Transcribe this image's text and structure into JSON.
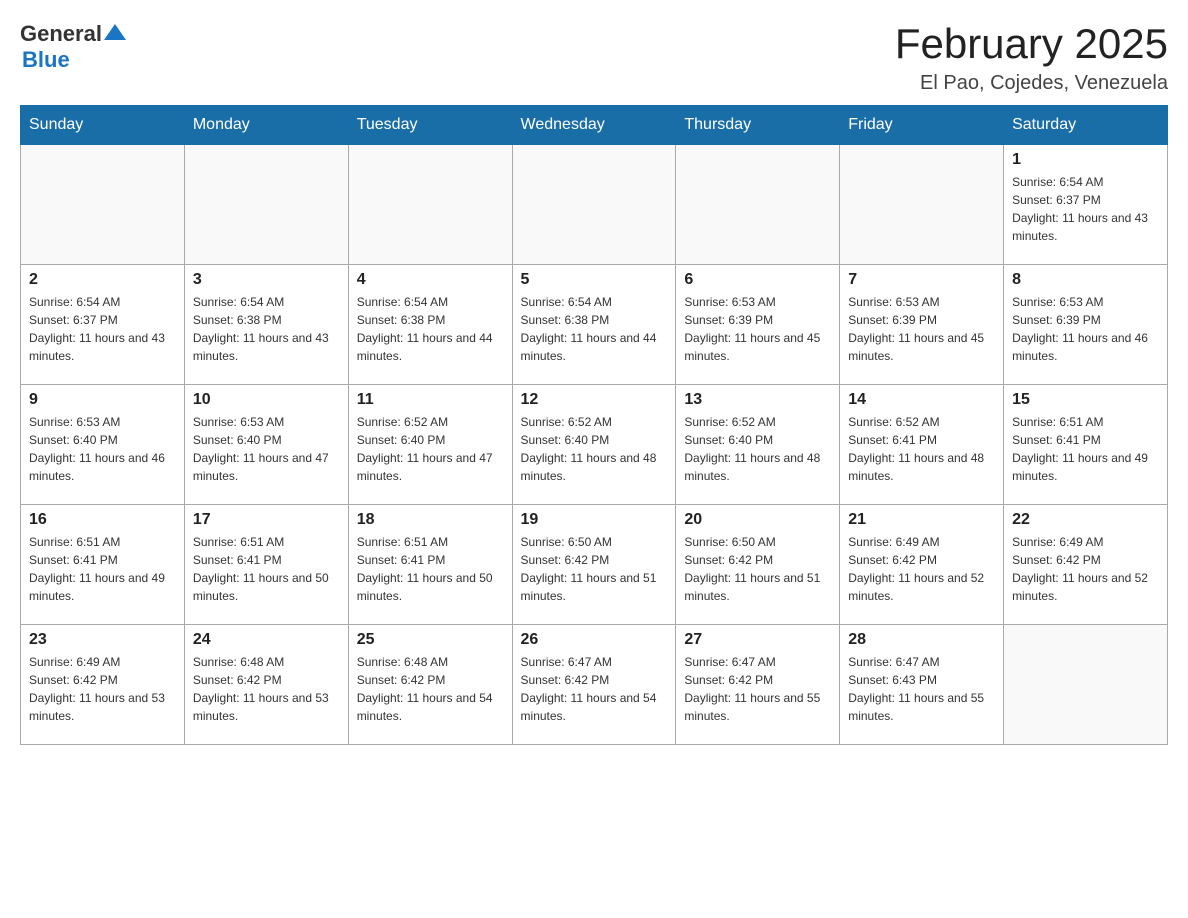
{
  "header": {
    "logo": {
      "general": "General",
      "triangle": "▲",
      "blue": "Blue"
    },
    "title": "February 2025",
    "subtitle": "El Pao, Cojedes, Venezuela"
  },
  "calendar": {
    "days": [
      "Sunday",
      "Monday",
      "Tuesday",
      "Wednesday",
      "Thursday",
      "Friday",
      "Saturday"
    ],
    "weeks": [
      [
        {
          "day": "",
          "info": ""
        },
        {
          "day": "",
          "info": ""
        },
        {
          "day": "",
          "info": ""
        },
        {
          "day": "",
          "info": ""
        },
        {
          "day": "",
          "info": ""
        },
        {
          "day": "",
          "info": ""
        },
        {
          "day": "1",
          "info": "Sunrise: 6:54 AM\nSunset: 6:37 PM\nDaylight: 11 hours and 43 minutes."
        }
      ],
      [
        {
          "day": "2",
          "info": "Sunrise: 6:54 AM\nSunset: 6:37 PM\nDaylight: 11 hours and 43 minutes."
        },
        {
          "day": "3",
          "info": "Sunrise: 6:54 AM\nSunset: 6:38 PM\nDaylight: 11 hours and 43 minutes."
        },
        {
          "day": "4",
          "info": "Sunrise: 6:54 AM\nSunset: 6:38 PM\nDaylight: 11 hours and 44 minutes."
        },
        {
          "day": "5",
          "info": "Sunrise: 6:54 AM\nSunset: 6:38 PM\nDaylight: 11 hours and 44 minutes."
        },
        {
          "day": "6",
          "info": "Sunrise: 6:53 AM\nSunset: 6:39 PM\nDaylight: 11 hours and 45 minutes."
        },
        {
          "day": "7",
          "info": "Sunrise: 6:53 AM\nSunset: 6:39 PM\nDaylight: 11 hours and 45 minutes."
        },
        {
          "day": "8",
          "info": "Sunrise: 6:53 AM\nSunset: 6:39 PM\nDaylight: 11 hours and 46 minutes."
        }
      ],
      [
        {
          "day": "9",
          "info": "Sunrise: 6:53 AM\nSunset: 6:40 PM\nDaylight: 11 hours and 46 minutes."
        },
        {
          "day": "10",
          "info": "Sunrise: 6:53 AM\nSunset: 6:40 PM\nDaylight: 11 hours and 47 minutes."
        },
        {
          "day": "11",
          "info": "Sunrise: 6:52 AM\nSunset: 6:40 PM\nDaylight: 11 hours and 47 minutes."
        },
        {
          "day": "12",
          "info": "Sunrise: 6:52 AM\nSunset: 6:40 PM\nDaylight: 11 hours and 48 minutes."
        },
        {
          "day": "13",
          "info": "Sunrise: 6:52 AM\nSunset: 6:40 PM\nDaylight: 11 hours and 48 minutes."
        },
        {
          "day": "14",
          "info": "Sunrise: 6:52 AM\nSunset: 6:41 PM\nDaylight: 11 hours and 48 minutes."
        },
        {
          "day": "15",
          "info": "Sunrise: 6:51 AM\nSunset: 6:41 PM\nDaylight: 11 hours and 49 minutes."
        }
      ],
      [
        {
          "day": "16",
          "info": "Sunrise: 6:51 AM\nSunset: 6:41 PM\nDaylight: 11 hours and 49 minutes."
        },
        {
          "day": "17",
          "info": "Sunrise: 6:51 AM\nSunset: 6:41 PM\nDaylight: 11 hours and 50 minutes."
        },
        {
          "day": "18",
          "info": "Sunrise: 6:51 AM\nSunset: 6:41 PM\nDaylight: 11 hours and 50 minutes."
        },
        {
          "day": "19",
          "info": "Sunrise: 6:50 AM\nSunset: 6:42 PM\nDaylight: 11 hours and 51 minutes."
        },
        {
          "day": "20",
          "info": "Sunrise: 6:50 AM\nSunset: 6:42 PM\nDaylight: 11 hours and 51 minutes."
        },
        {
          "day": "21",
          "info": "Sunrise: 6:49 AM\nSunset: 6:42 PM\nDaylight: 11 hours and 52 minutes."
        },
        {
          "day": "22",
          "info": "Sunrise: 6:49 AM\nSunset: 6:42 PM\nDaylight: 11 hours and 52 minutes."
        }
      ],
      [
        {
          "day": "23",
          "info": "Sunrise: 6:49 AM\nSunset: 6:42 PM\nDaylight: 11 hours and 53 minutes."
        },
        {
          "day": "24",
          "info": "Sunrise: 6:48 AM\nSunset: 6:42 PM\nDaylight: 11 hours and 53 minutes."
        },
        {
          "day": "25",
          "info": "Sunrise: 6:48 AM\nSunset: 6:42 PM\nDaylight: 11 hours and 54 minutes."
        },
        {
          "day": "26",
          "info": "Sunrise: 6:47 AM\nSunset: 6:42 PM\nDaylight: 11 hours and 54 minutes."
        },
        {
          "day": "27",
          "info": "Sunrise: 6:47 AM\nSunset: 6:42 PM\nDaylight: 11 hours and 55 minutes."
        },
        {
          "day": "28",
          "info": "Sunrise: 6:47 AM\nSunset: 6:43 PM\nDaylight: 11 hours and 55 minutes."
        },
        {
          "day": "",
          "info": ""
        }
      ]
    ]
  }
}
